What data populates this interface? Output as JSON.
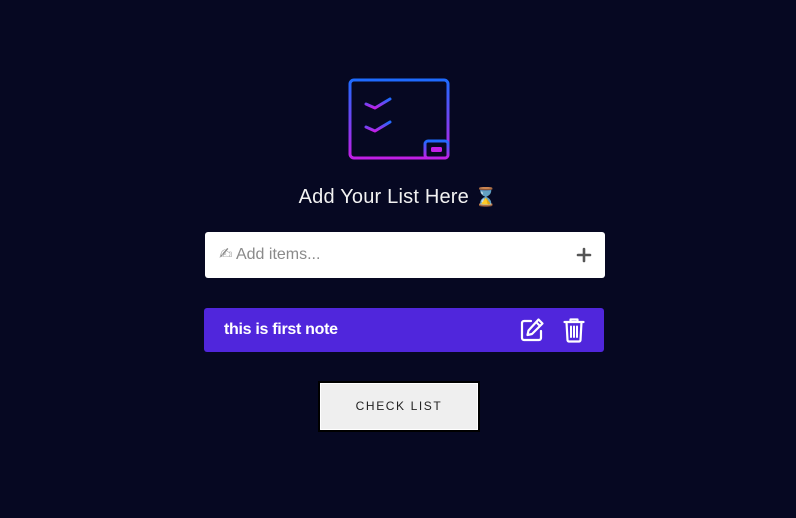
{
  "header": {
    "logo_icon": "checklist-icon",
    "title": "Add Your List Here",
    "title_emoji": "⌛"
  },
  "add_item": {
    "placeholder": "✍ Add items...",
    "value": "",
    "add_icon": "plus-icon"
  },
  "notes": [
    {
      "text": "this is first note",
      "edit_icon": "edit-icon",
      "delete_icon": "trash-icon"
    }
  ],
  "check_list_button": {
    "label": "CHECK LIST"
  },
  "colors": {
    "background": "#060822",
    "note_background": "#5026dc",
    "logo_gradient_start": "#1e6bff",
    "logo_gradient_end": "#c21fe6"
  }
}
